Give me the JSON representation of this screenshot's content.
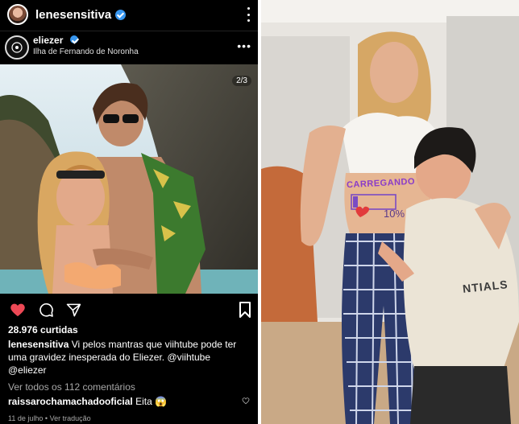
{
  "top": {
    "username": "lenesensitiva"
  },
  "post": {
    "username": "eliezer",
    "location": "Ilha de Fernando de Noronha",
    "more": "•••",
    "counter": "2/3",
    "likes": "28.976 curtidas",
    "caption_user": "lenesensitiva",
    "caption_text": "Vi pelos mantras que  viihtube pode ter uma gravidez inesperada do Eliezer. @viihtube @eliezer",
    "view_comments": "Ver todos os 112 comentários",
    "comment_user": "raissarochamachadooficial",
    "comment_text": "Eita 😱",
    "date": "11 de julho",
    "separator": "•",
    "translate": "Ver tradução"
  },
  "right_photo": {
    "belly_text": "CARREGANDO",
    "percent": "10%",
    "loading_progress": 0.1,
    "sweater_text": "NTIALS"
  },
  "colors": {
    "accent": "#ed4956",
    "verified": "#3897f0",
    "belly_text": "#8a3cc8"
  }
}
